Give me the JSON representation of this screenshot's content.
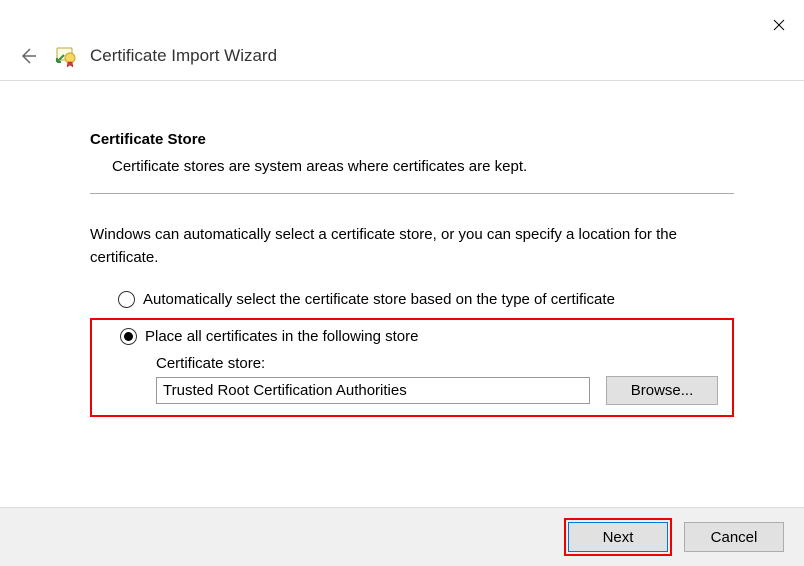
{
  "window": {
    "title": "Certificate Import Wizard"
  },
  "section": {
    "title": "Certificate Store",
    "description": "Certificate stores are system areas where certificates are kept."
  },
  "instruction": "Windows can automatically select a certificate store, or you can specify a location for the certificate.",
  "radio": {
    "auto": "Automatically select the certificate store based on the type of certificate",
    "place": "Place all certificates in the following store",
    "selected": "place"
  },
  "store": {
    "label": "Certificate store:",
    "value": "Trusted Root Certification Authorities",
    "browse_label": "Browse..."
  },
  "footer": {
    "next": "Next",
    "cancel": "Cancel"
  }
}
